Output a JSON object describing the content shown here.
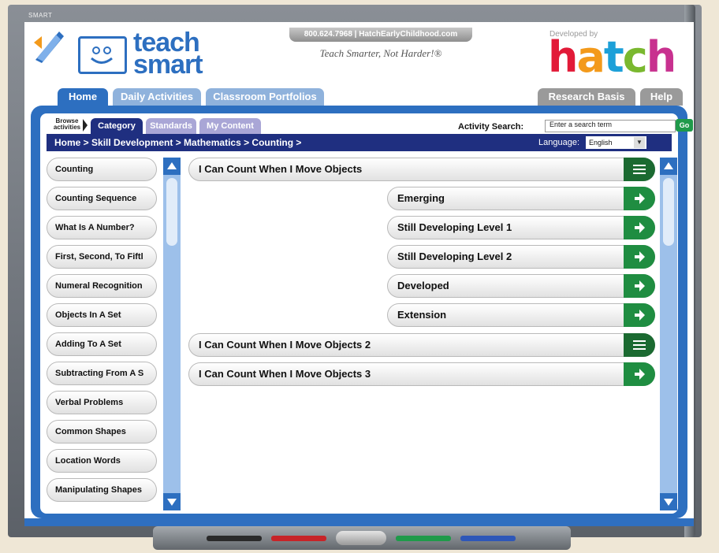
{
  "frame": {
    "brand": "SMART"
  },
  "header": {
    "logo_text_1": "teach",
    "logo_text_2": "smart",
    "contact": "800.624.7968 | HatchEarlyChildhood.com",
    "tagline": "Teach Smarter, Not Harder!®",
    "developed_by": "Developed by",
    "brand_letters": [
      "h",
      "a",
      "t",
      "c",
      "h"
    ]
  },
  "tabs": {
    "home": "Home",
    "daily": "Daily Activities",
    "portfolio": "Classroom Portfolios",
    "research": "Research Basis",
    "help": "Help"
  },
  "subnav": {
    "browse": "Browse activities",
    "category": "Category",
    "standards": "Standards",
    "my_content": "My Content",
    "search_label": "Activity Search:",
    "search_placeholder": "Enter a search term",
    "go": "Go"
  },
  "breadcrumb": "Home  >  Skill Development  >  Mathematics  >  Counting  >",
  "language": {
    "label": "Language:",
    "value": "English"
  },
  "sidebar": {
    "items": [
      "Counting",
      "Counting Sequence",
      "What Is A Number?",
      "First, Second, To Fiftl",
      "Numeral Recognition",
      "Objects In A Set",
      "Adding To A Set",
      "Subtracting From A S",
      "Verbal Problems",
      "Common Shapes",
      "Location Words",
      "Manipulating Shapes"
    ]
  },
  "activities": [
    {
      "label": "I Can Count When I Move Objects",
      "icon": "list-icon"
    },
    {
      "label": "Emerging",
      "icon": "arrow-right-icon"
    },
    {
      "label": "Still Developing  Level 1",
      "icon": "arrow-right-icon"
    },
    {
      "label": "Still Developing  Level 2",
      "icon": "arrow-right-icon"
    },
    {
      "label": "Developed",
      "icon": "arrow-right-icon"
    },
    {
      "label": "Extension",
      "icon": "arrow-right-icon"
    },
    {
      "label": "I Can Count When I Move Objects 2",
      "icon": "list-icon"
    },
    {
      "label": "I Can Count When I Move Objects 3",
      "icon": "arrow-right-icon"
    }
  ],
  "colors": {
    "primary_blue": "#2d6fc0",
    "navy": "#1f2f80",
    "green": "#1f8d41"
  }
}
